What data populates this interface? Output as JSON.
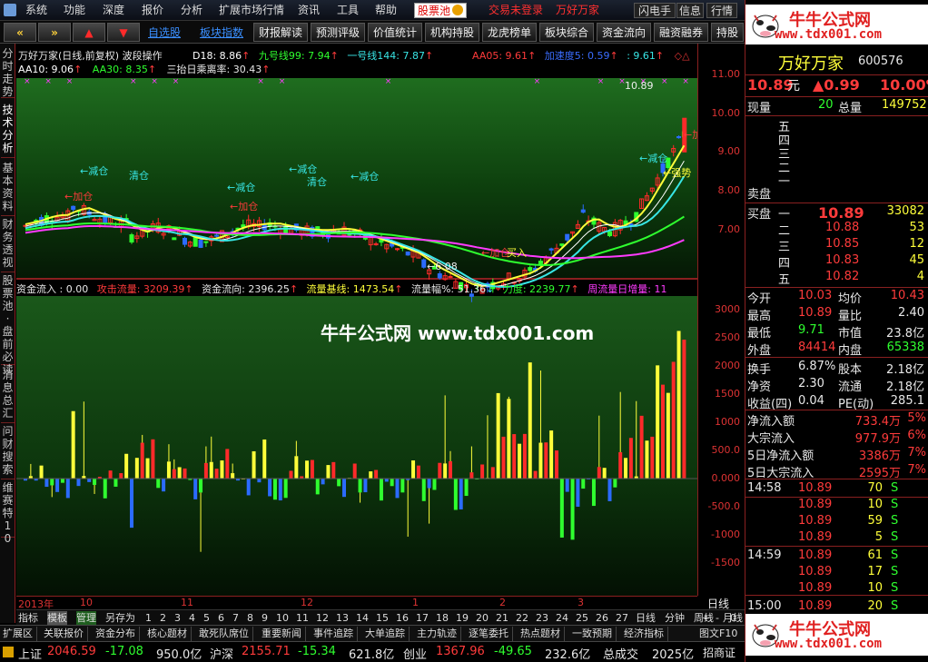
{
  "menu": [
    "系统",
    "功能",
    "深度",
    "报价",
    "分析",
    "扩展市场行情",
    "资讯",
    "工具",
    "帮助"
  ],
  "menu_highlight": "股票池",
  "menu_status": [
    "交易未登录",
    "万好万家"
  ],
  "menu_right": [
    "闪电手",
    "信息",
    "行情"
  ],
  "toolbar": {
    "links": [
      "自选股",
      "板块指数"
    ],
    "buttons": [
      "财报解读",
      "预测评级",
      "价值统计",
      "机构持股",
      "龙虎榜单",
      "板块综合",
      "资金流向",
      "融资融券",
      "持股"
    ]
  },
  "left_tabs": [
    "分时走势",
    "技术分析",
    "基本资料",
    "财务透视",
    "股票池·盘前必读",
    "消息总汇",
    "问财搜索",
    "维赛特10"
  ],
  "main_chart": {
    "title": "万好万家(日线,前复权)",
    "indicator": "波段操作",
    "legend_line1": [
      {
        "text": "D18: 8.86",
        "color": "#ffffff"
      },
      {
        "text": "九号线99: 7.94",
        "color": "#2fff2f"
      },
      {
        "text": "一号线144: 7.87",
        "color": "#38e6e6"
      },
      {
        "text": "AA05: 9.61",
        "color": "#ff3b3b"
      },
      {
        "text": "加速度5: 0.59",
        "color": "#3a6dff"
      },
      {
        "text": ": 9.61",
        "color": "#38e6e6"
      }
    ],
    "legend_line2": [
      {
        "text": "AA10: 9.06",
        "color": "#ffffff"
      },
      {
        "text": "AA30: 8.35",
        "color": "#2fff2f"
      },
      {
        "text": "三抬日乘离率: 30.43",
        "color": "#e8e8e8"
      }
    ],
    "y_ticks": [
      "11.00",
      "10.00",
      "9.00",
      "8.00",
      "7.00"
    ],
    "high_label": "10.89",
    "low_label": "←6.08",
    "annotations": [
      {
        "text": "←减仓",
        "color": "#38e6e6"
      },
      {
        "text": "清仓",
        "color": "#38e6e6"
      },
      {
        "text": "←加仓",
        "color": "#ff3b3b"
      },
      {
        "text": "←减仓",
        "color": "#38e6e6"
      },
      {
        "text": "←加仓",
        "color": "#ff3b3b"
      },
      {
        "text": "←减仓",
        "color": "#38e6e6"
      },
      {
        "text": "清仓",
        "color": "#38e6e6"
      },
      {
        "text": "←减仓",
        "color": "#38e6e6"
      },
      {
        "text": "←加仓",
        "color": "#ff3b3b"
      },
      {
        "text": "买入",
        "color": "#ffff3a"
      },
      {
        "text": "←减仓",
        "color": "#38e6e6"
      },
      {
        "text": "←强势",
        "color": "#ffff3a"
      },
      {
        "text": "←加",
        "color": "#ff3b3b"
      }
    ]
  },
  "flow_chart": {
    "legend": [
      {
        "text": "资金流入 : 0.00",
        "color": "#e8e8e8"
      },
      {
        "text": "攻击流量: 3209.39",
        "color": "#ff3b3b"
      },
      {
        "text": "资金流向: 2396.25",
        "color": "#e8e8e8"
      },
      {
        "text": "流量基线: 1473.54",
        "color": "#ffff3a"
      },
      {
        "text": "流量幅%: 51.36",
        "color": "#e8e8e8"
      },
      {
        "text": "力度: 2239.77",
        "color": "#2fff2f"
      },
      {
        "text": "周流量日增量: 11",
        "color": "#ff3bff"
      }
    ],
    "y_ticks": [
      "3000",
      "2500",
      "2000",
      "1500",
      "1000",
      "500.0",
      "0.000",
      "-500.0",
      "-1000",
      "-1500"
    ],
    "watermark": "牛牛公式网 www.tdx001.com"
  },
  "x_axis": {
    "labels": [
      "2013年",
      "10",
      "11",
      "12",
      "1",
      "2",
      "3"
    ],
    "right": "日线"
  },
  "bottom_tabs": [
    "指标",
    "模板",
    "管理",
    "另存为",
    "1",
    "2",
    "3",
    "4",
    "5",
    "6",
    "7",
    "8",
    "9",
    "10",
    "11",
    "12",
    "13",
    "14",
    "15",
    "16",
    "17",
    "18",
    "19",
    "20",
    "21",
    "22",
    "23",
    "24",
    "25",
    "26",
    "27",
    "日线",
    "分钟",
    "周线",
    "月线"
  ],
  "sector_tabs": [
    "扩展区",
    "关联报价",
    "资金分布",
    "核心题材",
    "敢死队席位",
    "重要新闻",
    "事件追踪",
    "大单追踪",
    "主力轨迹",
    "逐笔委托",
    "热点题材",
    "一致预期",
    "经济指标"
  ],
  "sector_right": "图文F10",
  "status_bar": [
    {
      "label": "上证",
      "value": "2046.59",
      "change": "-17.08",
      "amount": "950.0亿"
    },
    {
      "label": "沪深",
      "value": "2155.71",
      "change": "-15.34",
      "amount": "621.8亿"
    },
    {
      "label": "创业",
      "value": "1367.96",
      "change": "-49.65",
      "amount": "232.6亿"
    }
  ],
  "status_extra": {
    "label": "总成交",
    "value": "2025亿",
    "broker": "招商证"
  },
  "logo": {
    "title": "牛牛公式网",
    "url": "www.tdx001.com"
  },
  "quote": {
    "name": "万好万家",
    "code": "600576",
    "price": "10.89",
    "price_unit": "元",
    "change": "▲0.99",
    "pct": "10.00%",
    "now_label": "现量",
    "now_vol": "20",
    "total_label": "总量",
    "total_vol": "149752",
    "sell_labels": [
      "五",
      "四",
      "三",
      "二",
      "一"
    ],
    "sell_title": "卖盘",
    "buy_title": "买盘",
    "buy": [
      {
        "lv": "一",
        "price": "10.89",
        "vol": "33082"
      },
      {
        "lv": "二",
        "price": "10.88",
        "vol": "53"
      },
      {
        "lv": "三",
        "price": "10.85",
        "vol": "12"
      },
      {
        "lv": "四",
        "price": "10.83",
        "vol": "45"
      },
      {
        "lv": "五",
        "price": "10.82",
        "vol": "4"
      }
    ],
    "stats": [
      {
        "l1": "今开",
        "v1": "10.03",
        "l2": "均价",
        "v2": "10.43"
      },
      {
        "l1": "最高",
        "v1": "10.89",
        "l2": "量比",
        "v2": "2.40"
      },
      {
        "l1": "最低",
        "v1": "9.71",
        "l2": "市值",
        "v2": "23.8亿"
      },
      {
        "l1": "外盘",
        "v1": "84414",
        "l2": "内盘",
        "v2": "65338"
      }
    ],
    "stats2": [
      {
        "l1": "换手",
        "v1": "6.87%",
        "l2": "股本",
        "v2": "2.18亿"
      },
      {
        "l1": "净资",
        "v1": "2.30",
        "l2": "流通",
        "v2": "2.18亿"
      },
      {
        "l1": "收益(四)",
        "v1": "0.04",
        "l2": "PE(动)",
        "v2": "285.1"
      }
    ],
    "flows": [
      {
        "label": "净流入额",
        "value": "733.4万",
        "pct": "5%"
      },
      {
        "label": "大宗流入",
        "value": "977.9万",
        "pct": "6%"
      },
      {
        "label": "5日净流入额",
        "value": "3386万",
        "pct": "7%"
      },
      {
        "label": "5日大宗流入",
        "value": "2595万",
        "pct": "7%"
      }
    ],
    "ticks": [
      {
        "time": "14:58",
        "price": "10.89",
        "vol": "70",
        "side": "S"
      },
      {
        "time": "",
        "price": "10.89",
        "vol": "10",
        "side": "S"
      },
      {
        "time": "",
        "price": "10.89",
        "vol": "59",
        "side": "S"
      },
      {
        "time": "",
        "price": "10.89",
        "vol": "5",
        "side": "S"
      },
      {
        "time": "14:59",
        "price": "10.89",
        "vol": "61",
        "side": "S"
      },
      {
        "time": "",
        "price": "10.89",
        "vol": "17",
        "side": "S"
      },
      {
        "time": "",
        "price": "10.89",
        "vol": "10",
        "side": "S"
      },
      {
        "time": "15:00",
        "price": "10.89",
        "vol": "20",
        "side": "S"
      }
    ]
  }
}
